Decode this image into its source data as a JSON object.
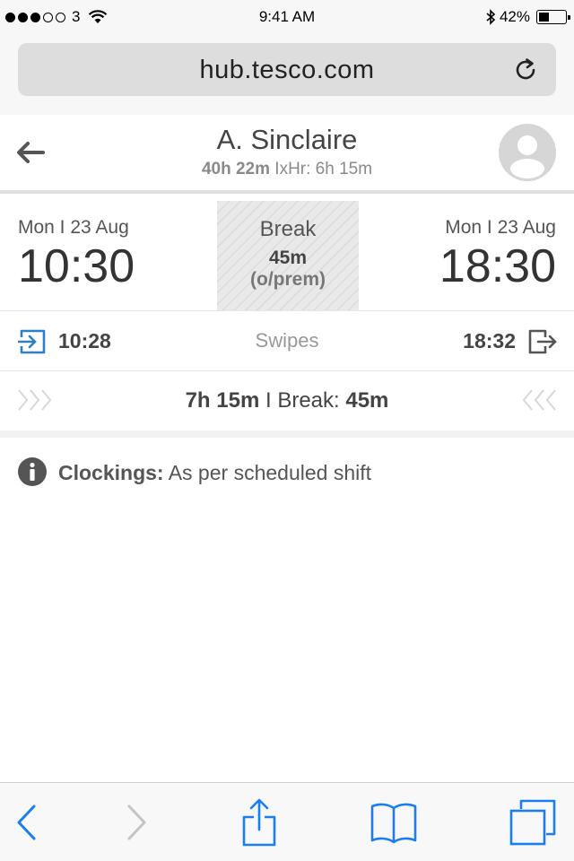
{
  "status_bar": {
    "carrier": "3",
    "time": "9:41 AM",
    "battery_percent": "42%",
    "battery_level": 0.42
  },
  "browser": {
    "url": "hub.tesco.com"
  },
  "header": {
    "name": "A. Sinclaire",
    "hours_total": "40h 22m",
    "separator": "I",
    "xhr_label": "xHr:",
    "xhr_value": "6h 15m"
  },
  "shift": {
    "start": {
      "date": "Mon I 23 Aug",
      "time": "10:30"
    },
    "end": {
      "date": "Mon I 23 Aug",
      "time": "18:30"
    },
    "break": {
      "title": "Break",
      "duration": "45m",
      "note": "(o/prem)"
    }
  },
  "swipes": {
    "in_time": "10:28",
    "label": "Swipes",
    "out_time": "18:32"
  },
  "duration": {
    "worked": "7h 15m",
    "separator": "I",
    "break_label": "Break:",
    "break_value": "45m"
  },
  "clockings": {
    "label": "Clockings:",
    "value": "As per scheduled shift"
  },
  "colors": {
    "accent_blue": "#2f7fc6",
    "toolbar_blue": "#1a7ef0",
    "avatar_grey": "#d6d6d6"
  },
  "icons": {
    "back": "arrow-left-icon",
    "reload": "reload-icon",
    "avatar": "user-avatar-icon",
    "swipe_in": "sign-in-icon",
    "swipe_out": "sign-out-icon",
    "info": "info-icon",
    "share": "share-icon",
    "bookmarks": "bookmarks-icon",
    "tabs": "tabs-icon"
  }
}
